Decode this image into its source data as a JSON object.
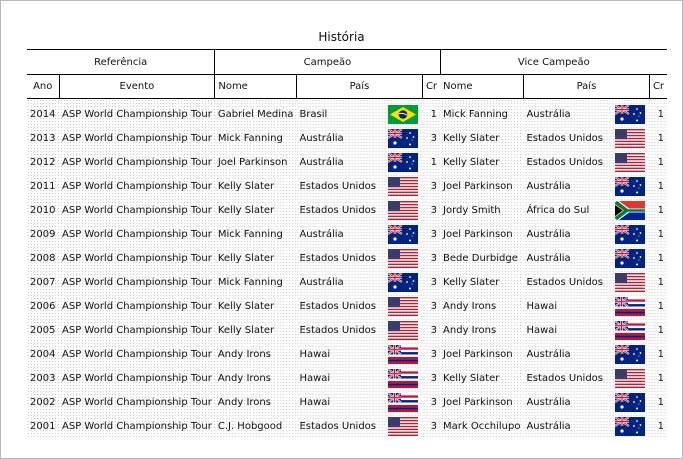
{
  "title": "História",
  "groups": {
    "referencia": "Referência",
    "campeao": "Campeão",
    "vice": "Vice Campeão"
  },
  "columns": {
    "ano": "Ano",
    "evento": "Evento",
    "nome": "Nome",
    "pais": "País",
    "cr": "Cr"
  },
  "rows": [
    {
      "ano": "2014",
      "evento": "ASP World Championship Tour",
      "champ": {
        "nome": "Gabriel Medina",
        "pais": "Brasil",
        "flag": "br",
        "cr": "1"
      },
      "vice": {
        "nome": "Mick Fanning",
        "pais": "Austrália",
        "flag": "au",
        "cr": "1"
      }
    },
    {
      "ano": "2013",
      "evento": "ASP World Championship Tour",
      "champ": {
        "nome": "Mick Fanning",
        "pais": "Austrália",
        "flag": "au",
        "cr": "3"
      },
      "vice": {
        "nome": "Kelly Slater",
        "pais": "Estados Unidos",
        "flag": "us",
        "cr": "1"
      }
    },
    {
      "ano": "2012",
      "evento": "ASP World Championship Tour",
      "champ": {
        "nome": "Joel Parkinson",
        "pais": "Austrália",
        "flag": "au",
        "cr": "1"
      },
      "vice": {
        "nome": "Kelly Slater",
        "pais": "Estados Unidos",
        "flag": "us",
        "cr": "1"
      }
    },
    {
      "ano": "2011",
      "evento": "ASP World Championship Tour",
      "champ": {
        "nome": "Kelly Slater",
        "pais": "Estados Unidos",
        "flag": "us",
        "cr": "3"
      },
      "vice": {
        "nome": "Joel Parkinson",
        "pais": "Austrália",
        "flag": "au",
        "cr": "1"
      }
    },
    {
      "ano": "2010",
      "evento": "ASP World Championship Tour",
      "champ": {
        "nome": "Kelly Slater",
        "pais": "Estados Unidos",
        "flag": "us",
        "cr": "3"
      },
      "vice": {
        "nome": "Jordy Smith",
        "pais": "África do Sul",
        "flag": "za",
        "cr": "1"
      }
    },
    {
      "ano": "2009",
      "evento": "ASP World Championship Tour",
      "champ": {
        "nome": "Mick Fanning",
        "pais": "Austrália",
        "flag": "au",
        "cr": "3"
      },
      "vice": {
        "nome": "Joel Parkinson",
        "pais": "Austrália",
        "flag": "au",
        "cr": "1"
      }
    },
    {
      "ano": "2008",
      "evento": "ASP World Championship Tour",
      "champ": {
        "nome": "Kelly Slater",
        "pais": "Estados Unidos",
        "flag": "us",
        "cr": "3"
      },
      "vice": {
        "nome": "Bede Durbidge",
        "pais": "Austrália",
        "flag": "au",
        "cr": "1"
      }
    },
    {
      "ano": "2007",
      "evento": "ASP World Championship Tour",
      "champ": {
        "nome": "Mick Fanning",
        "pais": "Austrália",
        "flag": "au",
        "cr": "3"
      },
      "vice": {
        "nome": "Kelly Slater",
        "pais": "Estados Unidos",
        "flag": "us",
        "cr": "1"
      }
    },
    {
      "ano": "2006",
      "evento": "ASP World Championship Tour",
      "champ": {
        "nome": "Kelly Slater",
        "pais": "Estados Unidos",
        "flag": "us",
        "cr": "3"
      },
      "vice": {
        "nome": "Andy Irons",
        "pais": "Hawai",
        "flag": "hi",
        "cr": "1"
      }
    },
    {
      "ano": "2005",
      "evento": "ASP World Championship Tour",
      "champ": {
        "nome": "Kelly Slater",
        "pais": "Estados Unidos",
        "flag": "us",
        "cr": "3"
      },
      "vice": {
        "nome": "Andy Irons",
        "pais": "Hawai",
        "flag": "hi",
        "cr": "1"
      }
    },
    {
      "ano": "2004",
      "evento": "ASP World Championship Tour",
      "champ": {
        "nome": "Andy Irons",
        "pais": "Hawai",
        "flag": "hi",
        "cr": "3"
      },
      "vice": {
        "nome": "Joel Parkinson",
        "pais": "Austrália",
        "flag": "au",
        "cr": "1"
      }
    },
    {
      "ano": "2003",
      "evento": "ASP World Championship Tour",
      "champ": {
        "nome": "Andy Irons",
        "pais": "Hawai",
        "flag": "hi",
        "cr": "3"
      },
      "vice": {
        "nome": "Kelly Slater",
        "pais": "Estados Unidos",
        "flag": "us",
        "cr": "1"
      }
    },
    {
      "ano": "2002",
      "evento": "ASP World Championship Tour",
      "champ": {
        "nome": "Andy Irons",
        "pais": "Hawai",
        "flag": "hi",
        "cr": "3"
      },
      "vice": {
        "nome": "Joel Parkinson",
        "pais": "Austrália",
        "flag": "au",
        "cr": "1"
      }
    },
    {
      "ano": "2001",
      "evento": "ASP World Championship Tour",
      "champ": {
        "nome": "C.J. Hobgood",
        "pais": "Estados Unidos",
        "flag": "us",
        "cr": "3"
      },
      "vice": {
        "nome": "Mark Occhilupo",
        "pais": "Austrália",
        "flag": "au",
        "cr": "1"
      }
    }
  ]
}
